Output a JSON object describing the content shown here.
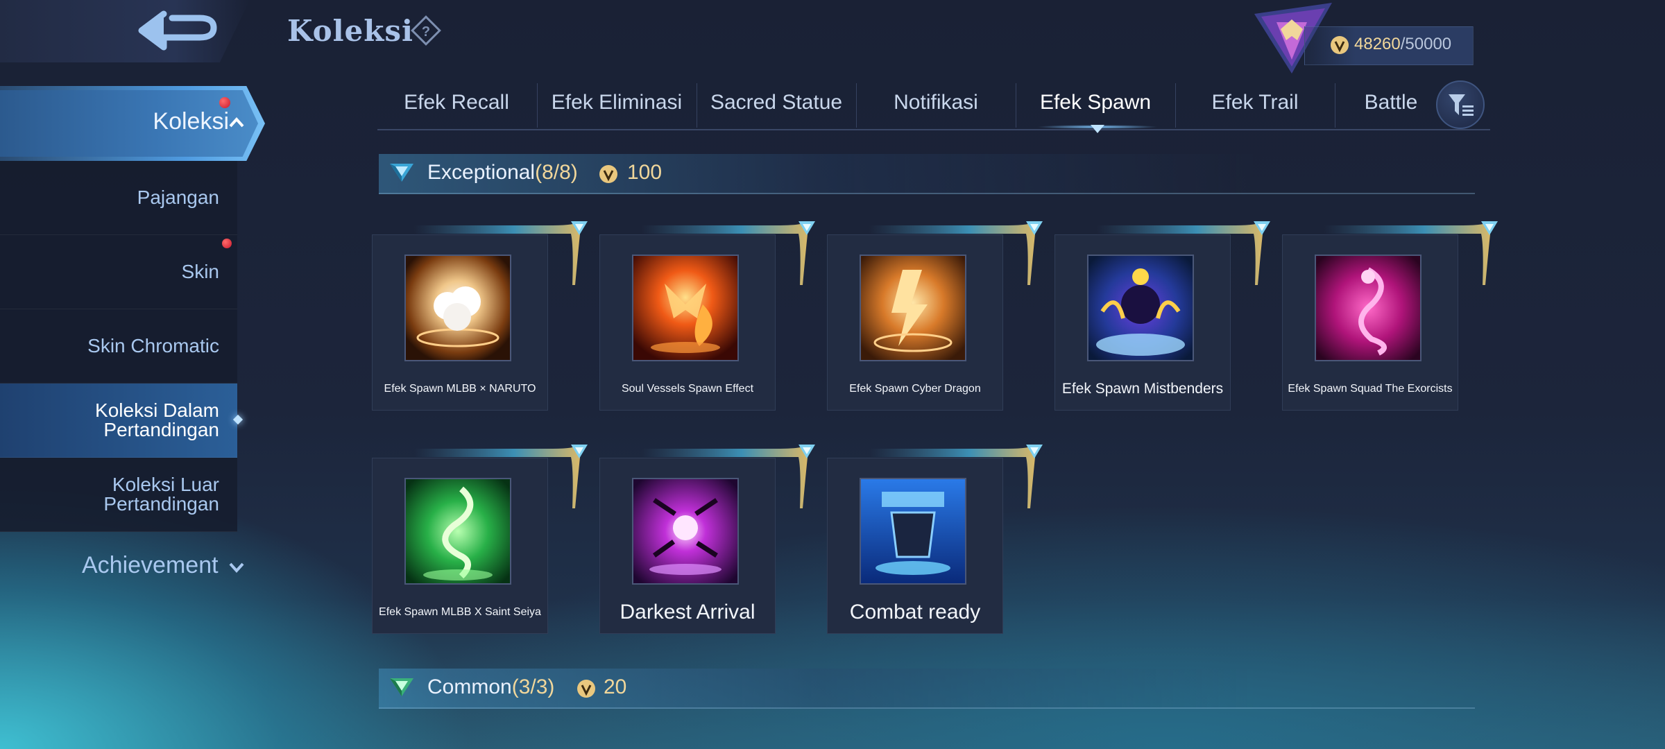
{
  "header": {
    "title": "Koleksi",
    "score": {
      "current": "48260",
      "max": "/50000"
    }
  },
  "sidebar": {
    "active": {
      "label": "Koleksi"
    },
    "items": [
      {
        "label": "Pajangan"
      },
      {
        "label": "Skin"
      },
      {
        "label": "Skin Chromatic"
      },
      {
        "label": "Koleksi Dalam Pertandingan"
      },
      {
        "label": "Koleksi Luar Pertandingan"
      }
    ],
    "achievement": "Achievement"
  },
  "tabs": [
    "Efek Recall",
    "Efek Eliminasi",
    "Sacred Statue",
    "Notifikasi",
    "Efek Spawn",
    "Efek Trail",
    "Battle"
  ],
  "active_tab": "Efek Spawn",
  "sections": [
    {
      "name": "Exceptional",
      "count": "(8/8)",
      "reward": "100",
      "items": [
        {
          "label": "Efek Spawn MLBB × NARUTO",
          "theme": "orange-white"
        },
        {
          "label": "Soul Vessels Spawn Effect",
          "theme": "red-fire"
        },
        {
          "label": "Efek Spawn Cyber Dragon",
          "theme": "orange-great"
        },
        {
          "label": "Efek Spawn Mistbenders",
          "theme": "blue-purple"
        },
        {
          "label": "Efek Spawn Squad The Exorcists",
          "theme": "magenta"
        },
        {
          "label": "Efek Spawn MLBB X Saint Seiya",
          "theme": "green-dragon"
        },
        {
          "label": "Darkest Arrival",
          "theme": "purple-dark"
        },
        {
          "label": "Combat ready",
          "theme": "blue-crate"
        }
      ]
    },
    {
      "name": "Common",
      "count": "(3/3)",
      "reward": "20"
    }
  ],
  "colors": {
    "accent_gold": "#f1d79b",
    "accent_blue": "#78c0f5",
    "notification_red": "#c8182c"
  }
}
